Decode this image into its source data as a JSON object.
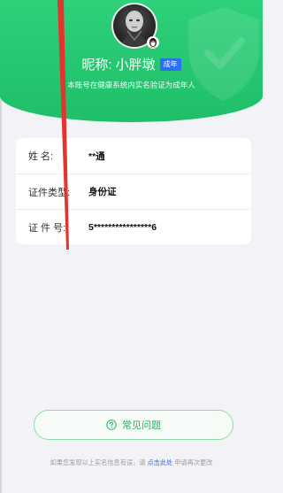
{
  "header": {
    "nickname": "昵称: 小胖墩",
    "badge": "成年",
    "verify_text": "本账号在健康系统内实名验证为成年人"
  },
  "info": {
    "rows": [
      {
        "label": "姓 名:",
        "value": "**通"
      },
      {
        "label": "证件类型:",
        "value": "身份证"
      },
      {
        "label": "证 件 号:",
        "value": "5****************6"
      }
    ]
  },
  "faq": {
    "label": "常见问题",
    "icon": "question-circle-icon"
  },
  "footer": {
    "text_before": "如果您发现以上实名信息有误，请",
    "link": "点击此处",
    "text_after": "申请再次更改"
  },
  "colors": {
    "header_green": "#1fbf6a",
    "accent_blue": "#2e6df6",
    "faq_green": "#22b35e",
    "annotation_red": "#e3342f"
  }
}
